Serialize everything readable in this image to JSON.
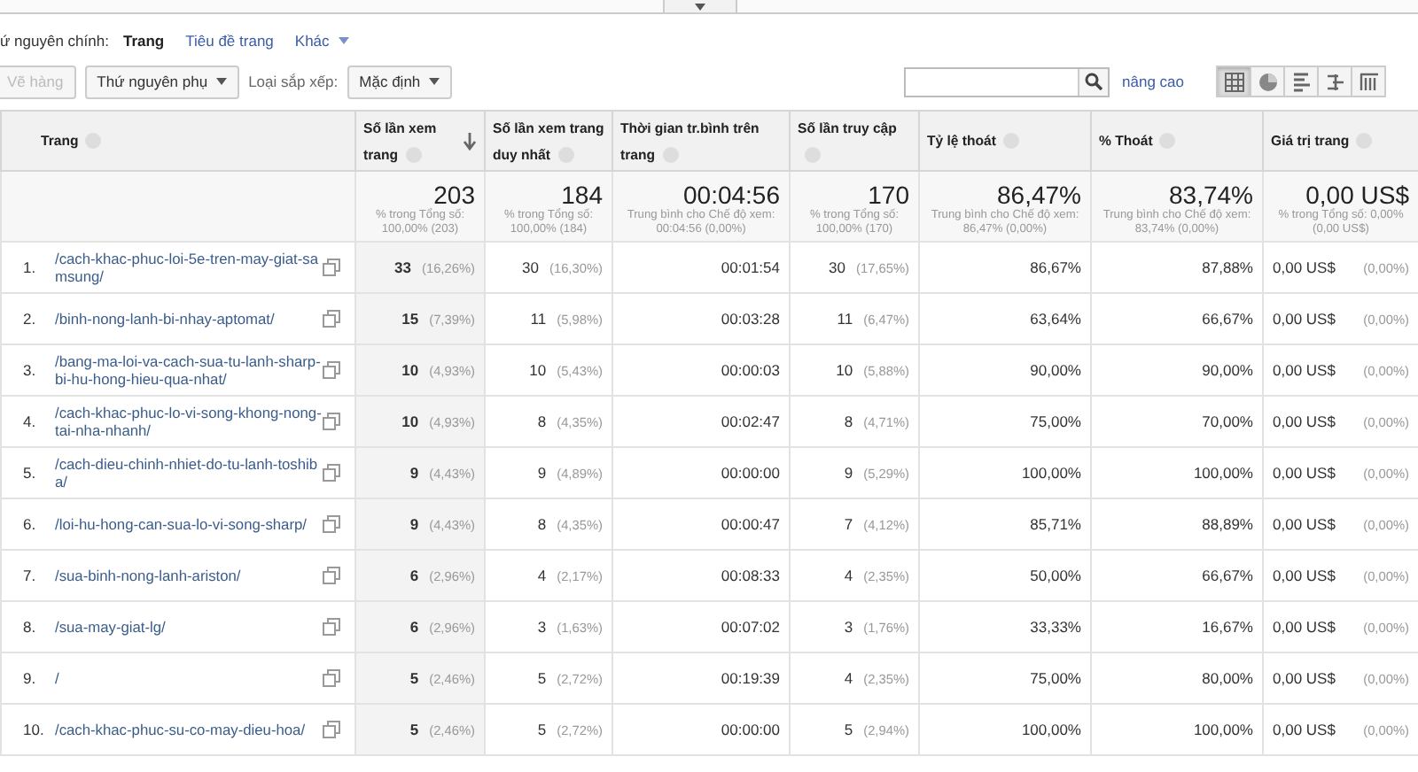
{
  "dimension_bar": {
    "label": "ứ nguyên chính:",
    "options": [
      {
        "label": "Trang",
        "selected": true,
        "kind": "link"
      },
      {
        "label": "Tiêu đề trang",
        "selected": false,
        "kind": "link"
      },
      {
        "label": "Khác",
        "selected": false,
        "kind": "menu"
      }
    ]
  },
  "toolbar": {
    "plot_button": {
      "label": "Vẽ hàng",
      "disabled": true
    },
    "secondary_dimension": "Thứ nguyên phụ",
    "sort_label": "Loại sắp xếp:",
    "sort_value": "Mặc định",
    "advanced_link": "nâng cao",
    "views": [
      {
        "kind": "table",
        "selected": true
      },
      {
        "kind": "pie",
        "selected": false
      },
      {
        "kind": "bars",
        "selected": false
      },
      {
        "kind": "compare",
        "selected": false
      },
      {
        "kind": "pivot",
        "selected": false
      }
    ]
  },
  "table": {
    "columns": [
      {
        "label": "Trang",
        "sorted": false
      },
      {
        "label": "Số lần xem trang",
        "sorted": true
      },
      {
        "label": "Số lần xem trang duy nhất",
        "sorted": false
      },
      {
        "label": "Thời gian tr.bình trên trang",
        "sorted": false
      },
      {
        "label": "Số lần truy cập",
        "sorted": false
      },
      {
        "label": "Tỷ lệ thoát",
        "sorted": false
      },
      {
        "label": "% Thoát",
        "sorted": false
      },
      {
        "label": "Giá trị trang",
        "sorted": false
      }
    ],
    "totals": [
      {
        "value": "203",
        "note": "% trong Tổng số: 100,00% (203)"
      },
      {
        "value": "184",
        "note": "% trong Tổng số: 100,00% (184)"
      },
      {
        "value": "00:04:56",
        "note": "Trung bình cho Chế độ xem: 00:04:56 (0,00%)"
      },
      {
        "value": "170",
        "note": "% trong Tổng số: 100,00% (170)"
      },
      {
        "value": "86,47%",
        "note": "Trung bình cho Chế độ xem: 86,47% (0,00%)"
      },
      {
        "value": "83,74%",
        "note": "Trung bình cho Chế độ xem: 83,74% (0,00%)"
      },
      {
        "value": "0,00 US$",
        "note": "% trong Tổng số: 0,00% (0,00 US$)"
      }
    ],
    "rows": [
      {
        "cells": [
          {
            "index": "1.",
            "page": "/cach-khac-phuc-loi-5e-tren-may-giat-samsung/"
          },
          {
            "value": "33",
            "share": "(16,26%)"
          },
          {
            "value": "30",
            "share": "(16,30%)"
          },
          {
            "value": "00:01:54"
          },
          {
            "value": "30",
            "share": "(17,65%)"
          },
          {
            "value": "86,67%"
          },
          {
            "value": "87,88%"
          },
          {
            "value": "0,00 US$",
            "share": "(0,00%)"
          }
        ]
      },
      {
        "cells": [
          {
            "index": "2.",
            "page": "/binh-nong-lanh-bi-nhay-aptomat/"
          },
          {
            "value": "15",
            "share": "(7,39%)"
          },
          {
            "value": "11",
            "share": "(5,98%)"
          },
          {
            "value": "00:03:28"
          },
          {
            "value": "11",
            "share": "(6,47%)"
          },
          {
            "value": "63,64%"
          },
          {
            "value": "66,67%"
          },
          {
            "value": "0,00 US$",
            "share": "(0,00%)"
          }
        ]
      },
      {
        "cells": [
          {
            "index": "3.",
            "page": "/bang-ma-loi-va-cach-sua-tu-lanh-sharp-bi-hu-hong-hieu-qua-nhat/"
          },
          {
            "value": "10",
            "share": "(4,93%)"
          },
          {
            "value": "10",
            "share": "(5,43%)"
          },
          {
            "value": "00:00:03"
          },
          {
            "value": "10",
            "share": "(5,88%)"
          },
          {
            "value": "90,00%"
          },
          {
            "value": "90,00%"
          },
          {
            "value": "0,00 US$",
            "share": "(0,00%)"
          }
        ]
      },
      {
        "cells": [
          {
            "index": "4.",
            "page": "/cach-khac-phuc-lo-vi-song-khong-nong-tai-nha-nhanh/"
          },
          {
            "value": "10",
            "share": "(4,93%)"
          },
          {
            "value": "8",
            "share": "(4,35%)"
          },
          {
            "value": "00:02:47"
          },
          {
            "value": "8",
            "share": "(4,71%)"
          },
          {
            "value": "75,00%"
          },
          {
            "value": "70,00%"
          },
          {
            "value": "0,00 US$",
            "share": "(0,00%)"
          }
        ]
      },
      {
        "cells": [
          {
            "index": "5.",
            "page": "/cach-dieu-chinh-nhiet-do-tu-lanh-toshiba/"
          },
          {
            "value": "9",
            "share": "(4,43%)"
          },
          {
            "value": "9",
            "share": "(4,89%)"
          },
          {
            "value": "00:00:00"
          },
          {
            "value": "9",
            "share": "(5,29%)"
          },
          {
            "value": "100,00%"
          },
          {
            "value": "100,00%"
          },
          {
            "value": "0,00 US$",
            "share": "(0,00%)"
          }
        ]
      },
      {
        "cells": [
          {
            "index": "6.",
            "page": "/loi-hu-hong-can-sua-lo-vi-song-sharp/"
          },
          {
            "value": "9",
            "share": "(4,43%)"
          },
          {
            "value": "8",
            "share": "(4,35%)"
          },
          {
            "value": "00:00:47"
          },
          {
            "value": "7",
            "share": "(4,12%)"
          },
          {
            "value": "85,71%"
          },
          {
            "value": "88,89%"
          },
          {
            "value": "0,00 US$",
            "share": "(0,00%)"
          }
        ]
      },
      {
        "cells": [
          {
            "index": "7.",
            "page": "/sua-binh-nong-lanh-ariston/"
          },
          {
            "value": "6",
            "share": "(2,96%)"
          },
          {
            "value": "4",
            "share": "(2,17%)"
          },
          {
            "value": "00:08:33"
          },
          {
            "value": "4",
            "share": "(2,35%)"
          },
          {
            "value": "50,00%"
          },
          {
            "value": "66,67%"
          },
          {
            "value": "0,00 US$",
            "share": "(0,00%)"
          }
        ]
      },
      {
        "cells": [
          {
            "index": "8.",
            "page": "/sua-may-giat-lg/"
          },
          {
            "value": "6",
            "share": "(2,96%)"
          },
          {
            "value": "3",
            "share": "(1,63%)"
          },
          {
            "value": "00:07:02"
          },
          {
            "value": "3",
            "share": "(1,76%)"
          },
          {
            "value": "33,33%"
          },
          {
            "value": "16,67%"
          },
          {
            "value": "0,00 US$",
            "share": "(0,00%)"
          }
        ]
      },
      {
        "cells": [
          {
            "index": "9.",
            "page": "/"
          },
          {
            "value": "5",
            "share": "(2,46%)"
          },
          {
            "value": "5",
            "share": "(2,72%)"
          },
          {
            "value": "00:19:39"
          },
          {
            "value": "4",
            "share": "(2,35%)"
          },
          {
            "value": "75,00%"
          },
          {
            "value": "80,00%"
          },
          {
            "value": "0,00 US$",
            "share": "(0,00%)"
          }
        ]
      },
      {
        "cells": [
          {
            "index": "10.",
            "page": "/cach-khac-phuc-su-co-may-dieu-hoa/"
          },
          {
            "value": "5",
            "share": "(2,46%)"
          },
          {
            "value": "5",
            "share": "(2,72%)"
          },
          {
            "value": "00:00:00"
          },
          {
            "value": "5",
            "share": "(2,94%)"
          },
          {
            "value": "100,00%"
          },
          {
            "value": "100,00%"
          },
          {
            "value": "0,00 US$",
            "share": "(0,00%)"
          }
        ]
      }
    ]
  }
}
